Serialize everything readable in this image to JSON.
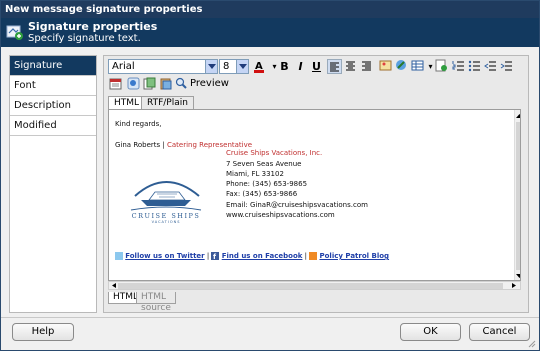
{
  "window": {
    "title": "New message signature properties"
  },
  "header": {
    "title": "Signature properties",
    "subtitle": "Specify signature text."
  },
  "sidebar": {
    "items": [
      {
        "label": "Signature"
      },
      {
        "label": "Font"
      },
      {
        "label": "Description"
      },
      {
        "label": "Modified"
      }
    ]
  },
  "toolbar": {
    "font": "Arial",
    "size": "8",
    "bold": "B",
    "italic": "I",
    "underline": "U",
    "preview": "Preview"
  },
  "tabs_top": [
    {
      "label": "HTML"
    },
    {
      "label": "RTF/Plain"
    }
  ],
  "tabs_bottom": [
    {
      "label": "HTML"
    },
    {
      "label": "HTML source"
    }
  ],
  "signature": {
    "greeting": "Kind regards,",
    "name": "Gina Roberts",
    "separator": "|",
    "role": "Catering Representative",
    "company": "Cruise Ships Vacations, Inc.",
    "address1": "7 Seven Seas Avenue",
    "address2": "Miami, FL 33102",
    "phone": "Phone: (345) 653-9865",
    "fax": "Fax: (345) 653-9866",
    "email": "Email: GinaR@cruiseshipsvacations.com",
    "web": "www.cruiseshipsvacations.com",
    "logo_text": "CRUISE SHIPS",
    "logo_sub": "VACATIONS",
    "links": [
      {
        "label": "Follow us on Twitter"
      },
      {
        "label": "Find us on Facebook"
      },
      {
        "label": "Policy Patrol Blog"
      }
    ]
  },
  "footer": {
    "help": "Help",
    "ok": "OK",
    "cancel": "Cancel"
  },
  "colors": {
    "header_bg": "#12395f",
    "accent_red": "#c03030",
    "link_blue": "#1f3fa8"
  }
}
